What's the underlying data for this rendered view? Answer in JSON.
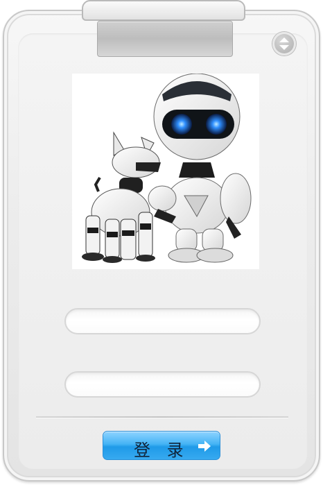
{
  "form": {
    "username_value": "",
    "password_value": ""
  },
  "login_button": {
    "label": "登 录",
    "icon": "arrow-right-icon"
  },
  "scroll_button": {
    "icon": "up-down-arrows-icon"
  },
  "illustration": {
    "subject": "robot-and-robot-dog"
  },
  "colors": {
    "accent": "#3aaaf0",
    "card_background": "#eeeeee"
  }
}
